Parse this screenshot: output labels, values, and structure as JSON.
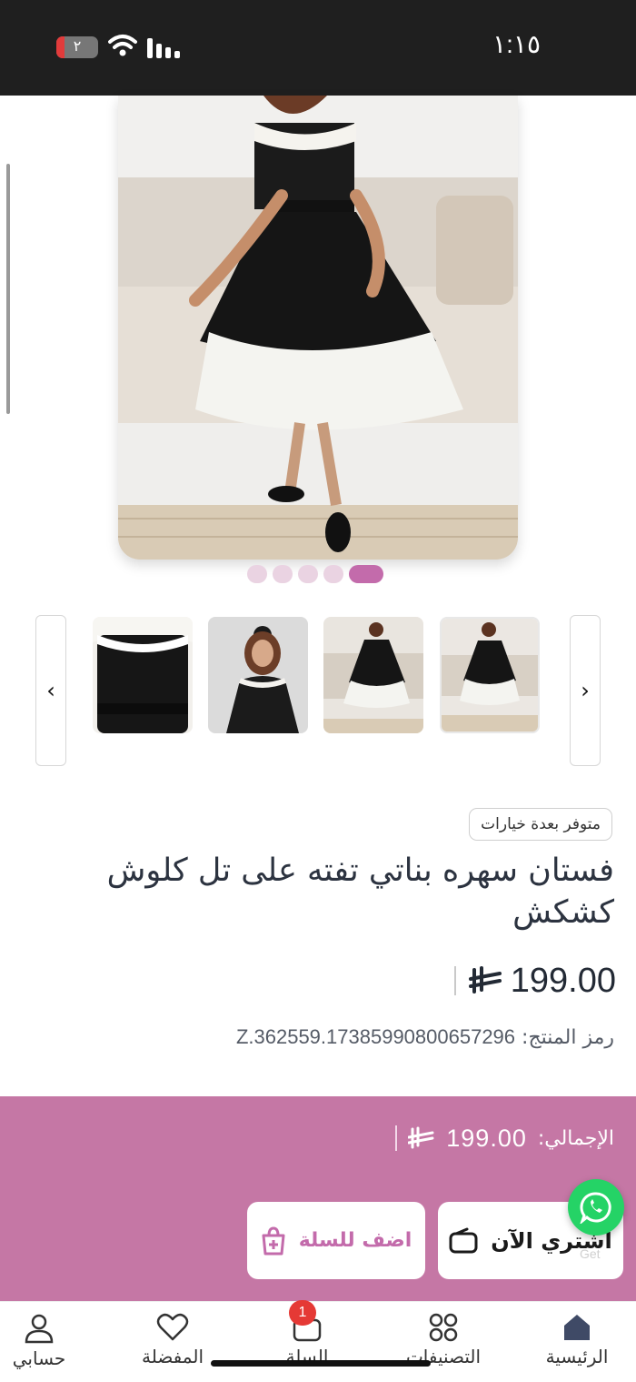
{
  "status_bar": {
    "time": "١:١٥",
    "battery_label": "٢",
    "battery_level": 0.2
  },
  "product": {
    "badge": "متوفر بعدة خيارات",
    "title": "فستان سهره بناتي تفته على تل كلوش كشكش",
    "price": "199.00",
    "sku_label": "رمز المنتج:",
    "sku_value": "Z.362559.17385990800657296"
  },
  "gallery": {
    "image_count": 5,
    "active_index": 4,
    "thumbnail_count": 4
  },
  "purchase": {
    "total_label": "الإجمالي:",
    "total_value": "199.00",
    "buy_now_label": "اشتري الآن",
    "add_to_cart_label": "اضف للسلة",
    "floating_tag": "Get"
  },
  "tabbar": {
    "items": [
      {
        "label": "الرئيسية",
        "icon": "home-icon"
      },
      {
        "label": "التصنيفات",
        "icon": "grid-icon"
      },
      {
        "label": "السلة",
        "icon": "cart-icon"
      },
      {
        "label": "المفضلة",
        "icon": "heart-icon"
      },
      {
        "label": "حسابي",
        "icon": "user-icon"
      }
    ],
    "cart_count": "1"
  },
  "colors": {
    "accent": "#c577a5",
    "whatsapp": "#25d366",
    "badge_red": "#e53935"
  }
}
